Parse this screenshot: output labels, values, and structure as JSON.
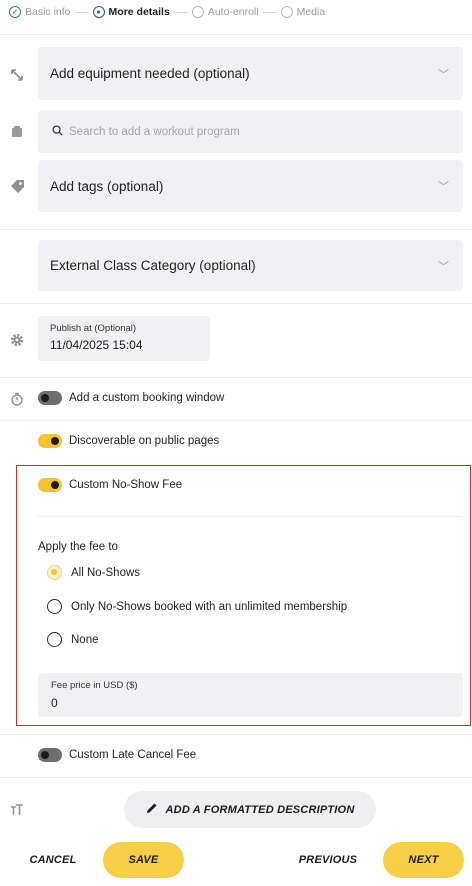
{
  "stepper": {
    "steps": [
      {
        "label": "Basic info",
        "state": "done"
      },
      {
        "label": "More details",
        "state": "active"
      },
      {
        "label": "Auto-enroll",
        "state": "pending"
      },
      {
        "label": "Media",
        "state": "pending"
      }
    ]
  },
  "equipment": {
    "label": "Add equipment needed (optional)"
  },
  "workout_search": {
    "placeholder": "Search to add a workout program"
  },
  "tags": {
    "label": "Add tags (optional)"
  },
  "external_category": {
    "label": "External Class Category (optional)"
  },
  "publish": {
    "label": "Publish at (Optional)",
    "value": "11/04/2025 15:04"
  },
  "toggles": {
    "booking_window": {
      "label": "Add a custom booking window",
      "on": false
    },
    "discoverable": {
      "label": "Discoverable on public pages",
      "on": true
    },
    "no_show_fee": {
      "label": "Custom No-Show Fee",
      "on": true
    },
    "late_cancel_fee": {
      "label": "Custom Late Cancel Fee",
      "on": false
    }
  },
  "apply_fee": {
    "heading": "Apply the fee to",
    "options": [
      {
        "label": "All No-Shows",
        "checked": true
      },
      {
        "label": "Only No-Shows booked with an unlimited membership",
        "checked": false
      },
      {
        "label": "None",
        "checked": false
      }
    ]
  },
  "fee_price": {
    "label": "Fee price in USD ($)",
    "value": "0"
  },
  "description": {
    "button_label": "ADD A FORMATTED DESCRIPTION"
  },
  "footer": {
    "cancel": "CANCEL",
    "save": "SAVE",
    "previous": "PREVIOUS",
    "next": "NEXT"
  },
  "colors": {
    "accent": "#f7cf47",
    "highlight_border": "#c9302c"
  }
}
